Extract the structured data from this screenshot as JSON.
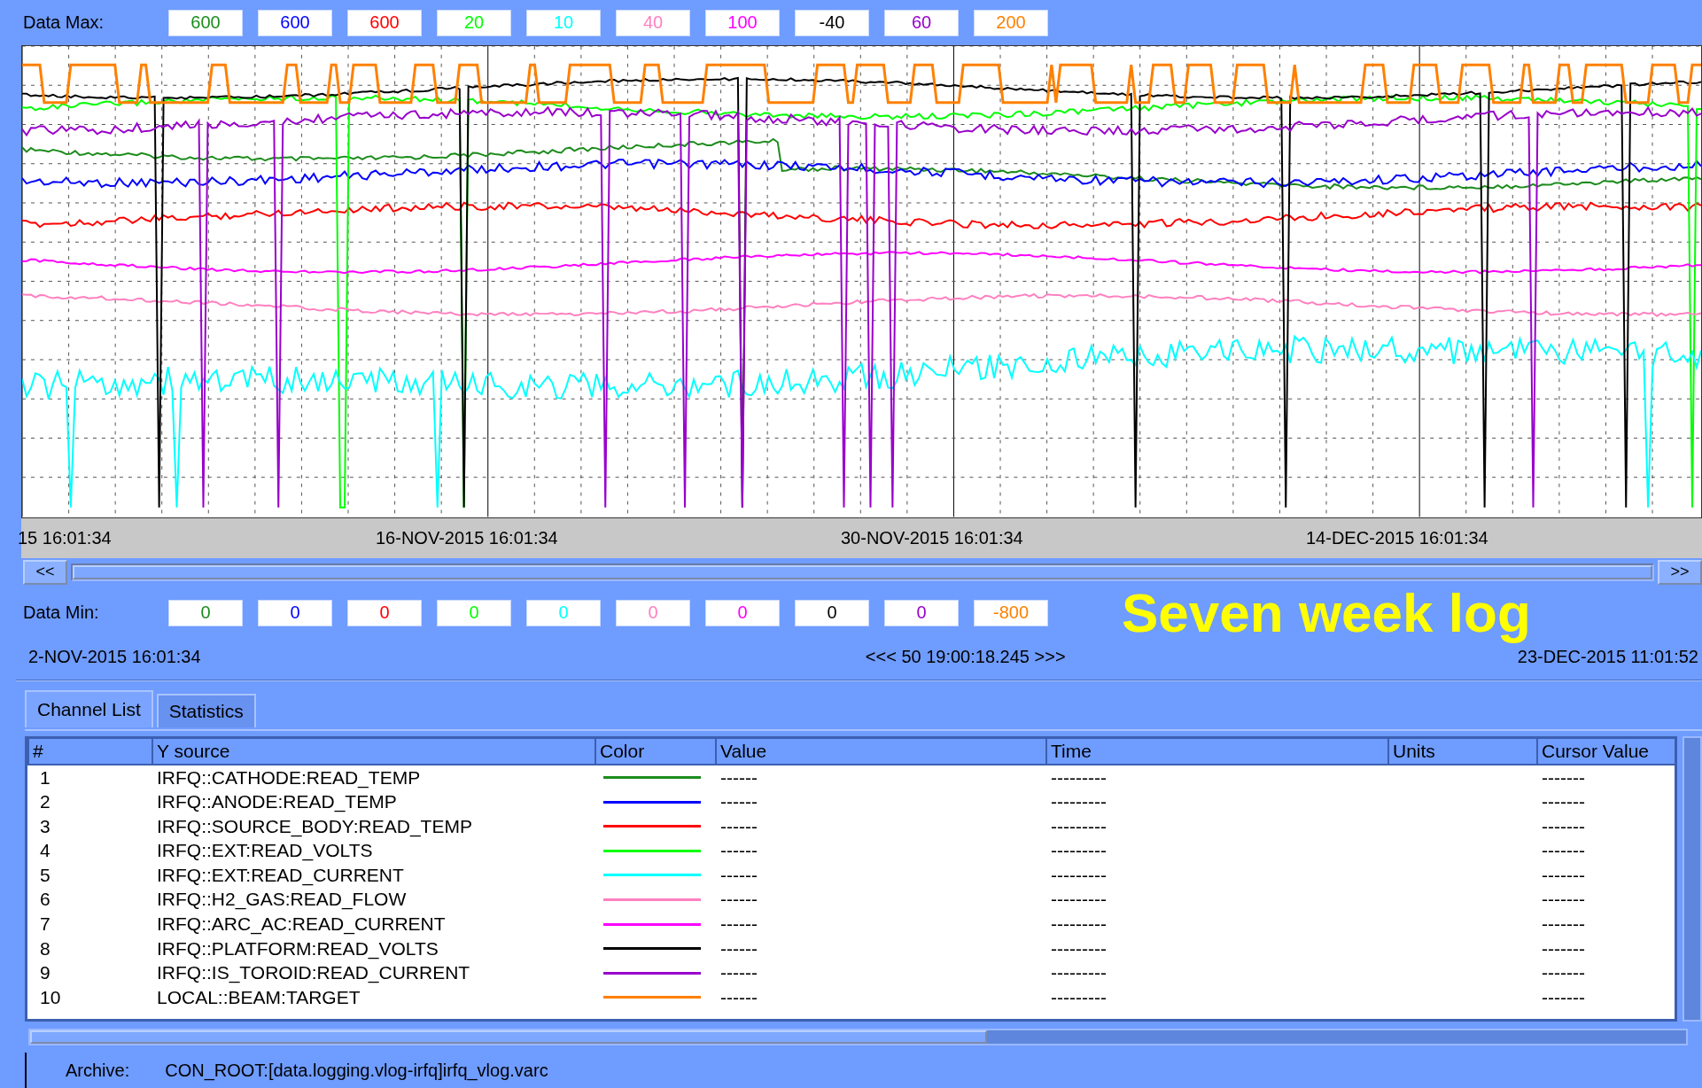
{
  "data_max_label": "Data Max:",
  "data_min_label": "Data Min:",
  "channels": [
    {
      "number": "1",
      "source": "IRFQ::CATHODE:READ_TEMP",
      "color": "#1c8c1c",
      "max": "600",
      "min": "0",
      "value": "------",
      "time": "---------",
      "cursor_value": "-------"
    },
    {
      "number": "2",
      "source": "IRFQ::ANODE:READ_TEMP",
      "color": "#0000ff",
      "max": "600",
      "min": "0",
      "value": "------",
      "time": "---------",
      "cursor_value": "-------"
    },
    {
      "number": "3",
      "source": "IRFQ::SOURCE_BODY:READ_TEMP",
      "color": "#ff0000",
      "max": "600",
      "min": "0",
      "value": "------",
      "time": "---------",
      "cursor_value": "-------"
    },
    {
      "number": "4",
      "source": "IRFQ::EXT:READ_VOLTS",
      "color": "#00ff00",
      "max": "20",
      "min": "0",
      "value": "------",
      "time": "---------",
      "cursor_value": "-------"
    },
    {
      "number": "5",
      "source": "IRFQ::EXT:READ_CURRENT",
      "color": "#00ffff",
      "max": "10",
      "min": "0",
      "value": "------",
      "time": "---------",
      "cursor_value": "-------"
    },
    {
      "number": "6",
      "source": "IRFQ::H2_GAS:READ_FLOW",
      "color": "#ff80c0",
      "max": "40",
      "min": "0",
      "value": "------",
      "time": "---------",
      "cursor_value": "-------"
    },
    {
      "number": "7",
      "source": "IRFQ::ARC_AC:READ_CURRENT",
      "color": "#ff00ff",
      "max": "100",
      "min": "0",
      "value": "------",
      "time": "---------",
      "cursor_value": "-------"
    },
    {
      "number": "8",
      "source": "IRFQ::PLATFORM:READ_VOLTS",
      "color": "#000000",
      "max": "-40",
      "min": "0",
      "value": "------",
      "time": "---------",
      "cursor_value": "-------"
    },
    {
      "number": "9",
      "source": "IRFQ::IS_TOROID:READ_CURRENT",
      "color": "#9900cc",
      "max": "60",
      "min": "0",
      "value": "------",
      "time": "---------",
      "cursor_value": "-------"
    },
    {
      "number": "10",
      "source": "LOCAL::BEAM:TARGET",
      "color": "#ff8000",
      "max": "200",
      "min": "-800",
      "value": "------",
      "time": "---------",
      "cursor_value": "-------"
    }
  ],
  "time_axis": [
    "15 16:01:34",
    "16-NOV-2015 16:01:34",
    "30-NOV-2015 16:01:34",
    "14-DEC-2015 16:01:34"
  ],
  "scroll_left": "<<",
  "scroll_right": ">>",
  "annotation": "Seven week log",
  "start_time": "2-NOV-2015 16:01:34",
  "span": "<<< 50 19:00:18.245 >>>",
  "end_time": "23-DEC-2015 11:01:52",
  "tabs": [
    {
      "label": "Channel List",
      "selected": true
    },
    {
      "label": "Statistics",
      "selected": false
    }
  ],
  "columns": [
    "#",
    "Y source",
    "Color",
    "Value",
    "Time",
    "Units",
    "Cursor Value"
  ],
  "archive_label": "Archive:",
  "archive_path": "CON_ROOT:[data.logging.vlog-irfq]irfq_vlog.varc"
}
